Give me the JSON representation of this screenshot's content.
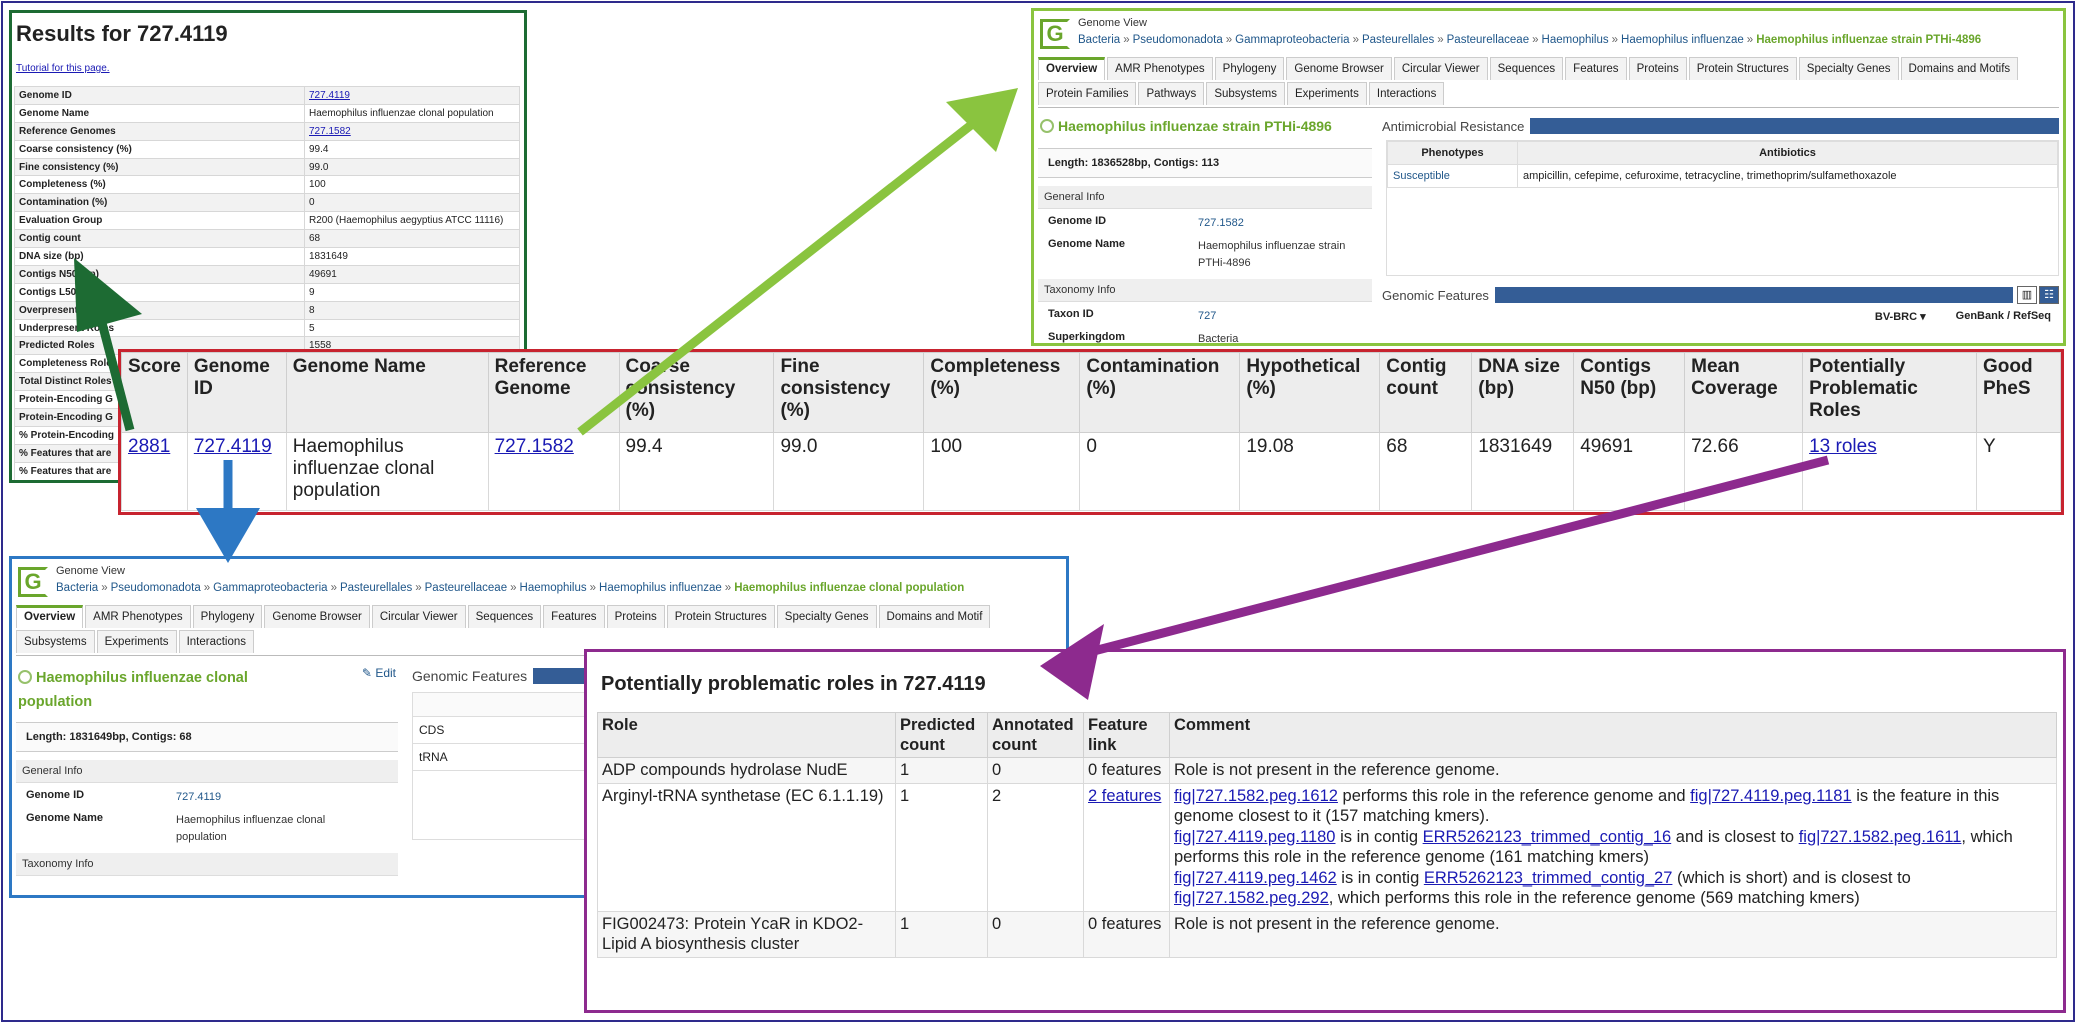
{
  "colors": {
    "frame": "#2e2a8c",
    "results_border": "#1d6b33",
    "gv_top_border": "#8ac43f",
    "main_table_border": "#c7232f",
    "gv_bottom_border": "#2d78c4",
    "roles_border": "#8d2a8e",
    "bvbrc_green": "#6aa62c",
    "bar_blue": "#345d96"
  },
  "results": {
    "title": "Results for 727.4119",
    "tutorial_link": "Tutorial for this page.",
    "rows": [
      {
        "label": "Genome ID",
        "value": "727.4119",
        "link": true
      },
      {
        "label": "Genome Name",
        "value": "Haemophilus influenzae clonal population",
        "link": false
      },
      {
        "label": "Reference Genomes",
        "value": "727.1582",
        "link": true
      },
      {
        "label": "Coarse consistency (%)",
        "value": "99.4",
        "link": false
      },
      {
        "label": "Fine consistency (%)",
        "value": "99.0",
        "link": false
      },
      {
        "label": "Completeness (%)",
        "value": "100",
        "link": false
      },
      {
        "label": "Contamination (%)",
        "value": "0",
        "link": false
      },
      {
        "label": "Evaluation Group",
        "value": "R200 (Haemophilus aegyptius ATCC 11116)",
        "link": false
      },
      {
        "label": "Contig count",
        "value": "68",
        "link": false
      },
      {
        "label": "DNA size (bp)",
        "value": "1831649",
        "link": false
      },
      {
        "label": "Contigs N50 (bp)",
        "value": "49691",
        "link": false
      },
      {
        "label": "Contigs L50",
        "value": "9",
        "link": false
      },
      {
        "label": "Overpresent Roles",
        "value": "8",
        "link": false
      },
      {
        "label": "Underpresent Roles",
        "value": "5",
        "link": false
      },
      {
        "label": "Predicted Roles",
        "value": "1558",
        "link": false
      },
      {
        "label": "Completeness Roles",
        "value": "",
        "link": false
      },
      {
        "label": "Total Distinct Roles",
        "value": "",
        "link": false
      },
      {
        "label": "Protein-Encoding G",
        "value": "",
        "link": false
      },
      {
        "label": "Protein-Encoding G",
        "value": "",
        "link": false
      },
      {
        "label": "% Protein-Encoding",
        "value": "",
        "link": false
      },
      {
        "label": "% Features that are",
        "value": "",
        "link": false
      },
      {
        "label": "% Features that are",
        "value": "",
        "link": false
      }
    ]
  },
  "genome_view_top": {
    "label": "Genome View",
    "breadcrumb": [
      "Bacteria",
      "Pseudomonadota",
      "Gammaproteobacteria",
      "Pasteurellales",
      "Pasteurellaceae",
      "Haemophilus",
      "Haemophilus influenzae"
    ],
    "breadcrumb_last": "Haemophilus influenzae strain PTHi-4896",
    "tabs_row1": [
      "Overview",
      "AMR Phenotypes",
      "Phylogeny",
      "Genome Browser",
      "Circular Viewer",
      "Sequences",
      "Features",
      "Proteins",
      "Protein Structures",
      "Specialty Genes",
      "Domains and Motifs"
    ],
    "tabs_row2": [
      "Protein Families",
      "Pathways",
      "Subsystems",
      "Experiments",
      "Interactions"
    ],
    "genome_title": "Haemophilus influenzae strain PTHi-4896",
    "length_line": "Length: 1836528bp, Contigs: 113",
    "general_info": "General Info",
    "genome_id_label": "Genome ID",
    "genome_id": "727.1582",
    "genome_name_label": "Genome Name",
    "genome_name": "Haemophilus influenzae strain PTHi-4896",
    "taxonomy_info": "Taxonomy Info",
    "taxon_id_label": "Taxon ID",
    "taxon_id": "727",
    "superkingdom_label": "Superkingdom",
    "superkingdom": "Bacteria",
    "amr_title": "Antimicrobial Resistance",
    "amr_headers": [
      "Phenotypes",
      "Antibiotics"
    ],
    "amr_phenotype": "Susceptible",
    "amr_antibiotics": "ampicillin, cefepime, cefuroxime, tetracycline, trimethoprim/sulfamethoxazole",
    "genomic_features": "Genomic Features",
    "bvbrc_col": "BV-BRC",
    "genbank_col": "GenBank / RefSeq"
  },
  "main_table": {
    "headers": [
      "Score",
      "Genome ID",
      "Genome Name",
      "Reference Genome",
      "Coarse consistency (%)",
      "Fine consistency (%)",
      "Completeness (%)",
      "Contamination (%)",
      "Hypothetical (%)",
      "Contig count",
      "DNA size (bp)",
      "Contigs N50 (bp)",
      "Mean Coverage",
      "Potentially Problematic Roles",
      "Good PheS"
    ],
    "row": {
      "score": "2881",
      "genome_id": "727.4119",
      "genome_name": "Haemophilus influenzae clonal population",
      "reference_genome": "727.1582",
      "coarse": "99.4",
      "fine": "99.0",
      "completeness": "100",
      "contamination": "0",
      "hypothetical": "19.08",
      "contig_count": "68",
      "dna_size": "1831649",
      "n50": "49691",
      "mean_coverage": "72.66",
      "problematic_roles": "13 roles",
      "good_phes": "Y"
    }
  },
  "genome_view_bottom": {
    "label": "Genome View",
    "breadcrumb": [
      "Bacteria",
      "Pseudomonadota",
      "Gammaproteobacteria",
      "Pasteurellales",
      "Pasteurellaceae",
      "Haemophilus",
      "Haemophilus influenzae"
    ],
    "breadcrumb_last": "Haemophilus influenzae clonal population",
    "tabs_row1": [
      "Overview",
      "AMR Phenotypes",
      "Phylogeny",
      "Genome Browser",
      "Circular Viewer",
      "Sequences",
      "Features",
      "Proteins",
      "Protein Structures",
      "Specialty Genes",
      "Domains and Motif"
    ],
    "tabs_row2": [
      "Subsystems",
      "Experiments",
      "Interactions"
    ],
    "genome_title": "Haemophilus influenzae clonal population",
    "edit_label": "Edit",
    "length_line": "Length: 1831649bp, Contigs: 68",
    "general_info": "General Info",
    "genome_id_label": "Genome ID",
    "genome_id": "727.4119",
    "genome_name_label": "Genome Name",
    "genome_name": "Haemophilus influenzae clonal population",
    "taxonomy_info": "Taxonomy Info",
    "genomic_features": "Genomic Features",
    "feature_rows": [
      "CDS",
      "tRNA"
    ]
  },
  "roles": {
    "title": "Potentially problematic roles in 727.4119",
    "headers": [
      "Role",
      "Predicted count",
      "Annotated count",
      "Feature link",
      "Comment"
    ],
    "rows": [
      {
        "role": "ADP compounds hydrolase NudE",
        "predicted": "1",
        "annotated": "0",
        "feature": "0 features",
        "feature_link": false,
        "comment": [
          {
            "t": "Role is not present in the reference genome.",
            "l": false
          }
        ]
      },
      {
        "role": "Arginyl-tRNA synthetase (EC 6.1.1.19)",
        "predicted": "1",
        "annotated": "2",
        "feature": "2 features",
        "feature_link": true,
        "comment": [
          {
            "t": "fig|727.1582.peg.1612",
            "l": true
          },
          {
            "t": " performs this role in the reference genome and ",
            "l": false
          },
          {
            "t": "fig|727.4119.peg.1181",
            "l": true
          },
          {
            "t": " is the feature in this genome closest to it (157 matching kmers).",
            "l": false
          },
          {
            "t": "\n",
            "l": false
          },
          {
            "t": "fig|727.4119.peg.1180",
            "l": true
          },
          {
            "t": " is in contig ",
            "l": false
          },
          {
            "t": "ERR5262123_trimmed_contig_16",
            "l": true
          },
          {
            "t": " and is closest to ",
            "l": false
          },
          {
            "t": "fig|727.1582.peg.1611",
            "l": true
          },
          {
            "t": ", which performs this role in the reference genome (161 matching kmers)",
            "l": false
          },
          {
            "t": "\n",
            "l": false
          },
          {
            "t": "fig|727.4119.peg.1462",
            "l": true
          },
          {
            "t": " is in contig ",
            "l": false
          },
          {
            "t": "ERR5262123_trimmed_contig_27",
            "l": true
          },
          {
            "t": " (which is short) and is closest to ",
            "l": false
          },
          {
            "t": "fig|727.1582.peg.292",
            "l": true
          },
          {
            "t": ", which performs this role in the reference genome (569 matching kmers)",
            "l": false
          }
        ]
      },
      {
        "role": "FIG002473: Protein YcaR in KDO2-Lipid A biosynthesis cluster",
        "predicted": "1",
        "annotated": "0",
        "feature": "0 features",
        "feature_link": false,
        "comment": [
          {
            "t": "Role is not present in the reference genome.",
            "l": false
          }
        ]
      }
    ]
  }
}
